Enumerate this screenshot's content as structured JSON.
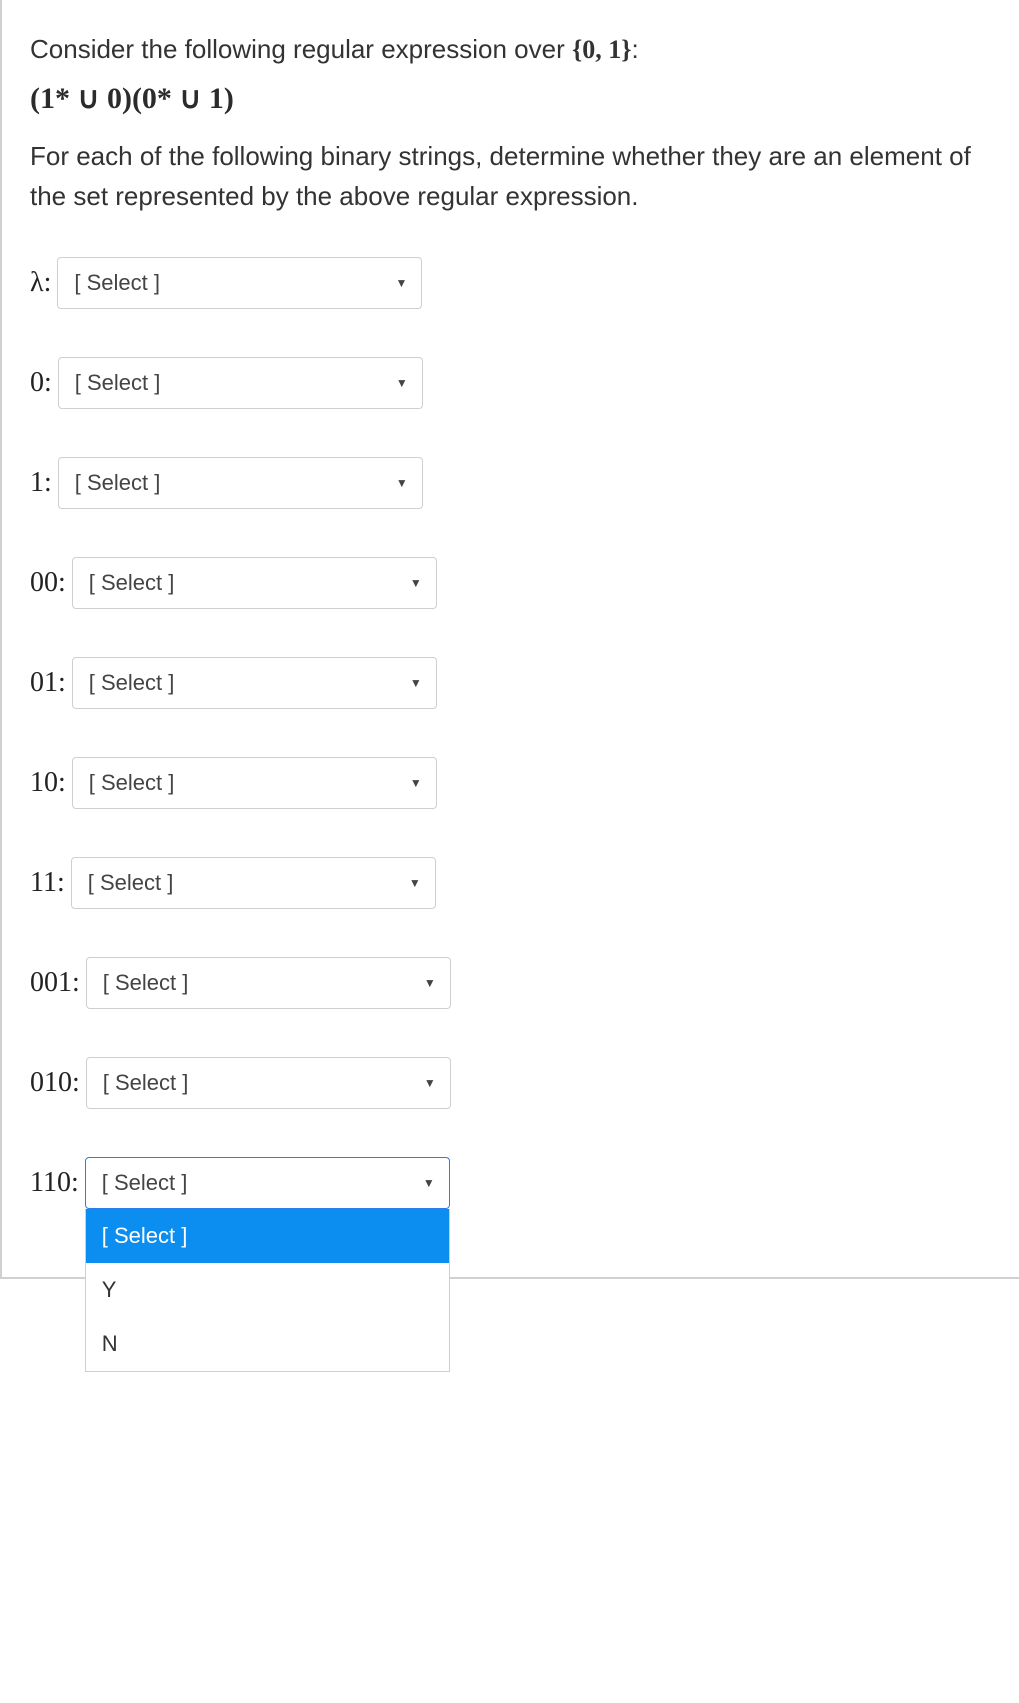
{
  "intro_prefix": "Consider the following regular expression over ",
  "alphabet": "{0, 1}",
  "intro_suffix": ":",
  "regex": "(1* ∪ 0)(0* ∪ 1)",
  "instruction": "For each of the following binary strings, determine whether they are an element of the set represented by the above regular expression.",
  "placeholder": "[ Select ]",
  "items": [
    {
      "label": "λ:",
      "value": "[ Select ]",
      "open": false
    },
    {
      "label": "0:",
      "value": "[ Select ]",
      "open": false
    },
    {
      "label": "1:",
      "value": "[ Select ]",
      "open": false
    },
    {
      "label": "00:",
      "value": "[ Select ]",
      "open": false
    },
    {
      "label": "01:",
      "value": "[ Select ]",
      "open": false
    },
    {
      "label": "10:",
      "value": "[ Select ]",
      "open": false
    },
    {
      "label": "11:",
      "value": "[ Select ]",
      "open": false
    },
    {
      "label": "001:",
      "value": "[ Select ]",
      "open": false
    },
    {
      "label": "010:",
      "value": "[ Select ]",
      "open": false
    },
    {
      "label": "110:",
      "value": "[ Select ]",
      "open": true
    }
  ],
  "options": [
    "[ Select ]",
    "Y",
    "N"
  ],
  "highlighted_option_index": 0
}
